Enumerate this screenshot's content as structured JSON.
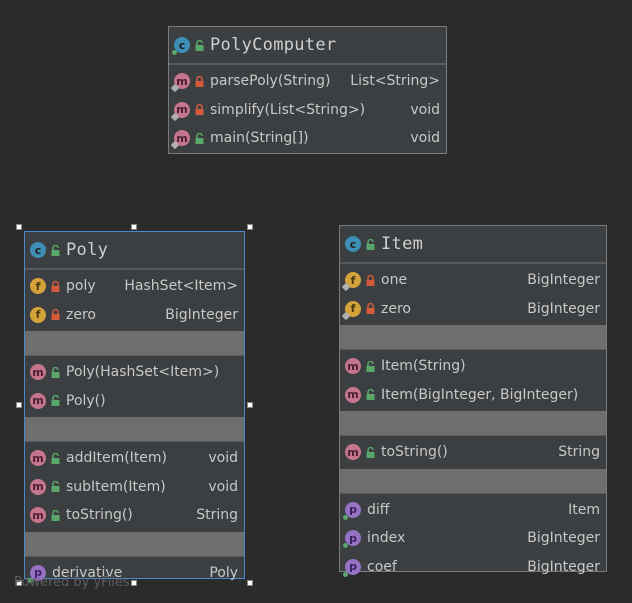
{
  "colors": {
    "background": "#2b2b2b",
    "class_fill": "#3c3f41",
    "class_border": "#7a7a7a",
    "selection_border": "#4a88c7",
    "class_icon": "#3d8fb5",
    "method_icon": "#c6768c",
    "field_icon": "#d4a23b",
    "property_icon": "#9672c4",
    "private_lock": "#d35a3a",
    "public_lock": "#59a869"
  },
  "polycomputer": {
    "name": "PolyComputer",
    "icon": "class-icon",
    "methods": [
      {
        "name": "parsePoly(String)",
        "type": "List<String>",
        "visibility": "private"
      },
      {
        "name": "simplify(List<String>)",
        "type": "void",
        "visibility": "private"
      },
      {
        "name": "main(String[])",
        "type": "void",
        "visibility": "public"
      }
    ]
  },
  "poly": {
    "name": "Poly",
    "icon": "class-icon",
    "fields": [
      {
        "name": "poly",
        "type": "HashSet<Item>",
        "visibility": "private"
      },
      {
        "name": "zero",
        "type": "BigInteger",
        "visibility": "private"
      }
    ],
    "constructors": [
      {
        "name": "Poly(HashSet<Item>)",
        "type": "",
        "visibility": "public"
      },
      {
        "name": "Poly()",
        "type": "",
        "visibility": "public"
      }
    ],
    "methods": [
      {
        "name": "addItem(Item)",
        "type": "void",
        "visibility": "public"
      },
      {
        "name": "subItem(Item)",
        "type": "void",
        "visibility": "public"
      },
      {
        "name": "toString()",
        "type": "String",
        "visibility": "public"
      }
    ],
    "properties": [
      {
        "name": "derivative",
        "type": "Poly"
      }
    ]
  },
  "item": {
    "name": "Item",
    "icon": "class-icon",
    "fields": [
      {
        "name": "one",
        "type": "BigInteger",
        "visibility": "private"
      },
      {
        "name": "zero",
        "type": "BigInteger",
        "visibility": "private"
      }
    ],
    "constructors": [
      {
        "name": "Item(String)",
        "type": "",
        "visibility": "public"
      },
      {
        "name": "Item(BigInteger, BigInteger)",
        "type": "",
        "visibility": "public"
      }
    ],
    "methods": [
      {
        "name": "toString()",
        "type": "String",
        "visibility": "public"
      }
    ],
    "properties": [
      {
        "name": "diff",
        "type": "Item"
      },
      {
        "name": "index",
        "type": "BigInteger"
      },
      {
        "name": "coef",
        "type": "BigInteger"
      }
    ]
  },
  "watermark": "Powered by yFiles"
}
